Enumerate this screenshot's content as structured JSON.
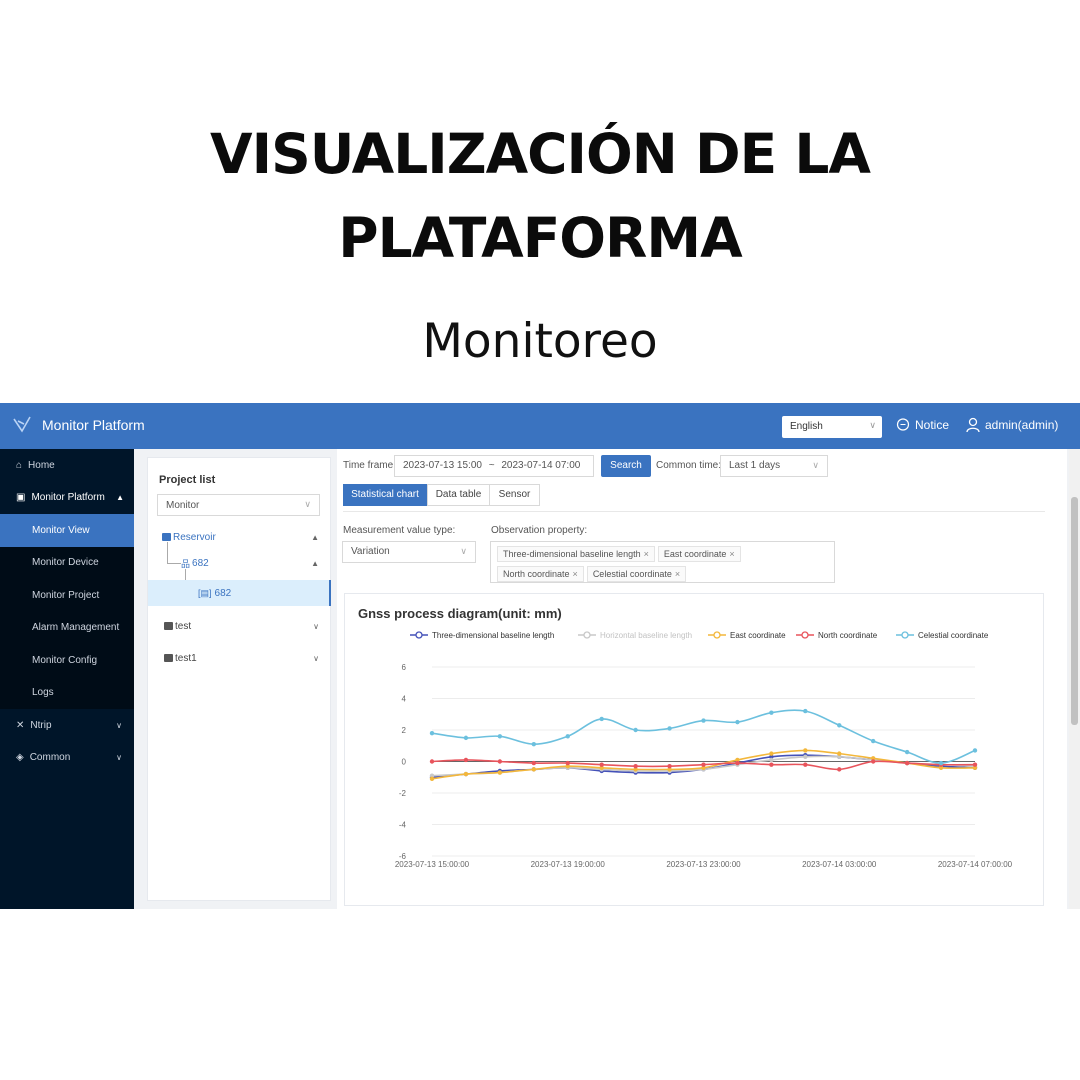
{
  "hero": {
    "title_line1": "VISUALIZACIÓN DE LA",
    "title_line2": "PLATAFORMA",
    "subtitle": "Monitoreo"
  },
  "topbar": {
    "brand": "Monitor Platform",
    "language": "English",
    "notice": "Notice",
    "user": "admin(admin)"
  },
  "sidebar": {
    "home": "Home",
    "monitor_platform": "Monitor Platform",
    "sub_items": [
      "Monitor View",
      "Monitor Device",
      "Monitor Project",
      "Alarm Management",
      "Monitor Config",
      "Logs"
    ],
    "ntrip": "Ntrip",
    "common": "Common"
  },
  "project_panel": {
    "title": "Project list",
    "select_value": "Monitor",
    "tree": {
      "reservoir": "Reservoir",
      "group": "682",
      "device": "682",
      "test": "test",
      "test1": "test1"
    }
  },
  "filters": {
    "time_frame_label": "Time frame:",
    "time_start": "2023-07-13 15:00",
    "time_sep": "~",
    "time_end": "2023-07-14 07:00",
    "search": "Search",
    "common_time_label": "Common time:",
    "common_time_value": "Last 1 days"
  },
  "tabs": [
    "Statistical chart",
    "Data table",
    "Sensor"
  ],
  "measurement": {
    "type_label": "Measurement value type:",
    "type_value": "Variation",
    "property_label": "Observation property:",
    "tags": [
      "Three-dimensional baseline length",
      "East coordinate",
      "North coordinate",
      "Celestial coordinate"
    ]
  },
  "chart_data": {
    "type": "line",
    "title": "Gnss process diagram(unit: mm)",
    "x": [
      "2023-07-13 15:00:00",
      "2023-07-13 16:00:00",
      "2023-07-13 17:00:00",
      "2023-07-13 18:00:00",
      "2023-07-13 19:00:00",
      "2023-07-13 20:00:00",
      "2023-07-13 21:00:00",
      "2023-07-13 22:00:00",
      "2023-07-13 23:00:00",
      "2023-07-14 00:00:00",
      "2023-07-14 01:00:00",
      "2023-07-14 02:00:00",
      "2023-07-14 03:00:00",
      "2023-07-14 04:00:00",
      "2023-07-14 05:00:00",
      "2023-07-14 06:00:00",
      "2023-07-14 07:00:00"
    ],
    "x_tick_labels": [
      "2023-07-13 15:00:00",
      "2023-07-13 19:00:00",
      "2023-07-13 23:00:00",
      "2023-07-14 03:00:00",
      "2023-07-14 07:00:00"
    ],
    "ylim": [
      -6,
      6
    ],
    "y_ticks": [
      6,
      4,
      2,
      0,
      -2,
      -4,
      -6
    ],
    "legend_position": "top",
    "series": [
      {
        "name": "Three-dimensional baseline length",
        "color": "#4451b8",
        "values": [
          -1.0,
          -0.8,
          -0.6,
          -0.5,
          -0.4,
          -0.6,
          -0.7,
          -0.7,
          -0.5,
          -0.1,
          0.3,
          0.4,
          0.3,
          0.1,
          -0.1,
          -0.3,
          -0.4
        ]
      },
      {
        "name": "Horizontal baseline length",
        "color": "#c8c8c8",
        "values": [
          -0.9,
          -0.8,
          -0.7,
          -0.5,
          -0.4,
          -0.5,
          -0.6,
          -0.6,
          -0.5,
          -0.2,
          0.1,
          0.3,
          0.3,
          0.1,
          -0.1,
          -0.2,
          -0.3
        ]
      },
      {
        "name": "East coordinate",
        "color": "#f3b73b",
        "values": [
          -1.1,
          -0.8,
          -0.7,
          -0.5,
          -0.3,
          -0.4,
          -0.5,
          -0.5,
          -0.4,
          0.1,
          0.5,
          0.7,
          0.5,
          0.2,
          -0.1,
          -0.4,
          -0.4
        ]
      },
      {
        "name": "North coordinate",
        "color": "#e8545c",
        "values": [
          0.0,
          0.1,
          0.0,
          -0.1,
          -0.1,
          -0.2,
          -0.3,
          -0.3,
          -0.2,
          -0.1,
          -0.2,
          -0.2,
          -0.5,
          0.0,
          -0.1,
          -0.2,
          -0.2
        ]
      },
      {
        "name": "Celestial coordinate",
        "color": "#6cc0de",
        "values": [
          1.8,
          1.5,
          1.6,
          1.1,
          1.6,
          2.7,
          2.0,
          2.1,
          2.6,
          2.5,
          3.1,
          3.2,
          2.3,
          1.3,
          0.6,
          -0.1,
          0.7
        ]
      }
    ]
  }
}
